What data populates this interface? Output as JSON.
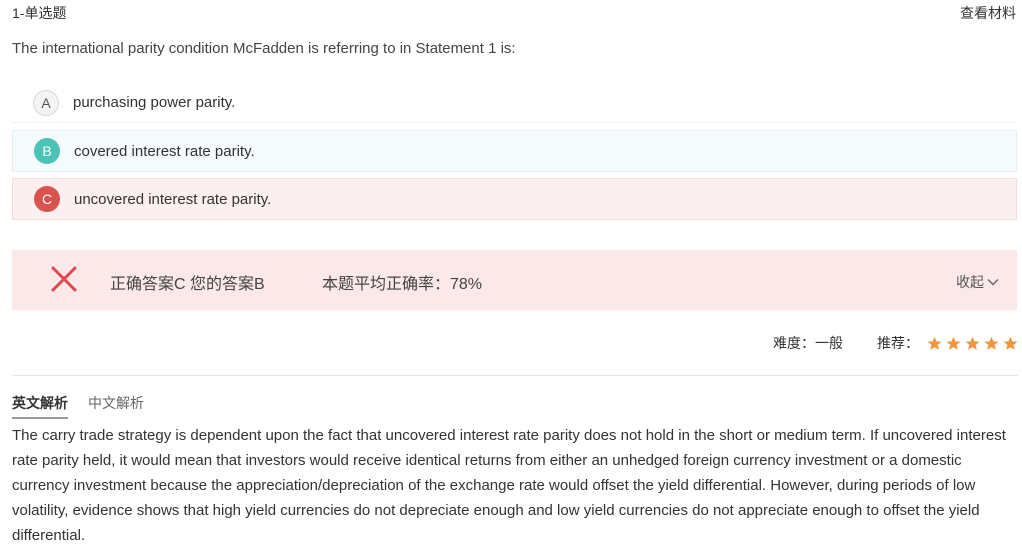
{
  "header": {
    "question_type": "1-单选题",
    "view_material": "查看材料"
  },
  "question": {
    "stem": "The international parity condition McFadden is referring to in Statement 1 is:"
  },
  "options": [
    {
      "letter": "A",
      "text": "purchasing power parity."
    },
    {
      "letter": "B",
      "text": "covered interest rate parity."
    },
    {
      "letter": "C",
      "text": "uncovered interest rate parity."
    }
  ],
  "result": {
    "answer_text": "正确答案C 您的答案B",
    "average_text": "本题平均正确率：78%",
    "collapse_label": "收起",
    "icon": "cross-icon",
    "color": "#e0474c"
  },
  "meta": {
    "difficulty": "难度：一般",
    "recommend_label": "推荐：",
    "rating": 5,
    "star_color": "#f0953a"
  },
  "tabs": [
    {
      "label": "英文解析",
      "active": true
    },
    {
      "label": "中文解析",
      "active": false
    }
  ],
  "explanation": "The carry trade strategy is dependent upon the fact that uncovered interest rate parity does not hold in the short or medium term. If uncovered interest rate parity held, it would mean that investors would receive identical returns from either an unhedged foreign currency investment or a domestic currency investment because the appreciation/depreciation of the exchange rate would offset the yield differential. However, during periods of low volatility, evidence shows that high yield currencies do not depreciate enough and low yield currencies do not appreciate enough to offset the yield differential."
}
